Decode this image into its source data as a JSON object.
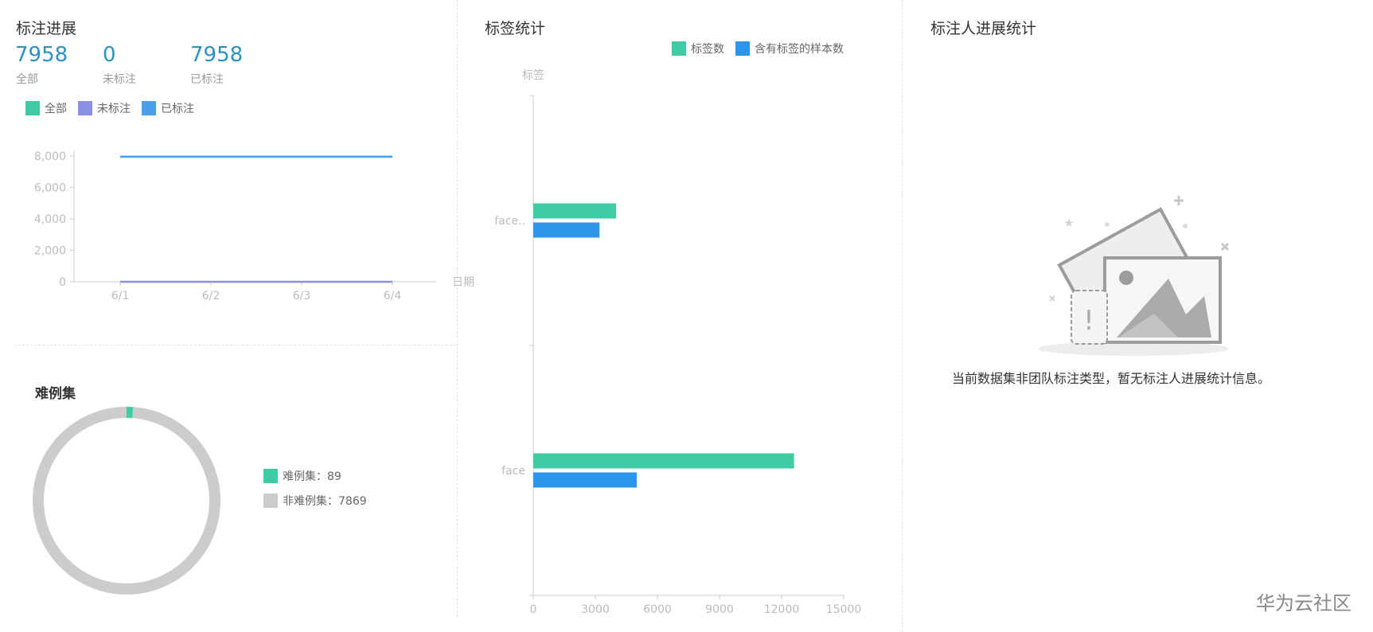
{
  "panels": {
    "progress": {
      "title": "标注进展",
      "stats": [
        {
          "value": "7958",
          "label": "全部"
        },
        {
          "value": "0",
          "label": "未标注"
        },
        {
          "value": "7958",
          "label": "已标注"
        }
      ],
      "legend": [
        {
          "label": "全部",
          "color": "#3ecca4"
        },
        {
          "label": "未标注",
          "color": "#8a8fe3"
        },
        {
          "label": "已标注",
          "color": "#4a9fec"
        }
      ]
    },
    "hard": {
      "title": "难例集"
    },
    "label_stats": {
      "title": "标签统计"
    },
    "annotator": {
      "title": "标注人进展统计",
      "empty_text": "当前数据集非团队标注类型，暂无标注人进展统计信息。"
    }
  },
  "watermark": "华为云社区",
  "chart_data": [
    {
      "id": "progress-line",
      "type": "line",
      "x": [
        "6/1",
        "6/2",
        "6/3",
        "6/4"
      ],
      "series": [
        {
          "name": "全部",
          "values": [
            7958,
            7958,
            7958,
            7958
          ],
          "color": "#3ecca4"
        },
        {
          "name": "未标注",
          "values": [
            0,
            0,
            0,
            0
          ],
          "color": "#8a8fe3"
        },
        {
          "name": "已标注",
          "values": [
            7958,
            7958,
            7958,
            7958
          ],
          "color": "#4a9fec"
        }
      ],
      "ylim": [
        0,
        8000
      ],
      "yticks": [
        0,
        2000,
        4000,
        6000,
        8000
      ],
      "ytick_labels": [
        "0",
        "2,000",
        "4,000",
        "6,000",
        "8,000"
      ],
      "xlabel": "日期"
    },
    {
      "id": "hard-pie",
      "type": "pie",
      "slices": [
        {
          "label": "难例集",
          "value": 89,
          "color": "#3ecca4",
          "legend": "难例集：89"
        },
        {
          "label": "非难例集",
          "value": 7869,
          "color": "#cccccc",
          "legend": "非难例集：7869"
        }
      ]
    },
    {
      "id": "label-bar",
      "type": "bar",
      "orientation": "horizontal",
      "categories": [
        "face..",
        "face"
      ],
      "series": [
        {
          "name": "标签数",
          "values": [
            4000,
            12600
          ],
          "color": "#3ecca4"
        },
        {
          "name": "含有标签的样本数",
          "values": [
            3200,
            5000
          ],
          "color": "#2b96ec"
        }
      ],
      "xlim": [
        0,
        15000
      ],
      "xticks": [
        0,
        3000,
        6000,
        9000,
        12000,
        15000
      ],
      "xtick_labels": [
        "0",
        "3000",
        "6000",
        "9000",
        "12000",
        "15000"
      ],
      "ylabel": "标签"
    }
  ]
}
